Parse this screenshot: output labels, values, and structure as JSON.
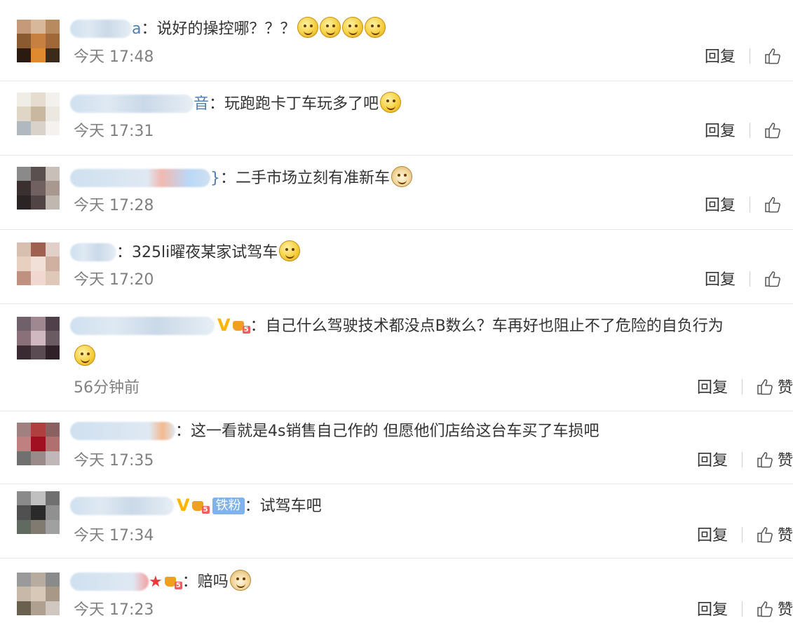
{
  "comments": [
    {
      "name_suffix": "a",
      "text": "说好的操控哪？？？",
      "time": "今天 17:48",
      "emojis": 4,
      "reply": "回复",
      "like": ""
    },
    {
      "name_suffix": "音",
      "text": "玩跑跑卡丁车玩多了吧",
      "time": "今天 17:31",
      "emojis": 1,
      "reply": "回复",
      "like": ""
    },
    {
      "name_suffix": "}",
      "text": "二手市场立刻有准新车",
      "time": "今天 17:28",
      "emojis": 1,
      "reply": "回复",
      "like": ""
    },
    {
      "name_suffix": "",
      "text": "325li曜夜某家试驾车",
      "time": "今天 17:20",
      "emojis": 1,
      "reply": "回复",
      "like": ""
    },
    {
      "name_suffix": "",
      "text": "自己什么驾驶技术都没点B数么？车再好也阻止不了危险的自负行为",
      "time": "56分钟前",
      "vip": "V",
      "reply": "回复",
      "like": "赞"
    },
    {
      "name_suffix": "",
      "text": "这一看就是4s销售自己作的 但愿他们店给这台车买了车损吧",
      "time": "今天 17:35",
      "reply": "回复",
      "like": "赞"
    },
    {
      "name_suffix": "",
      "text": "试驾车吧",
      "time": "今天 17:34",
      "vip": "V",
      "badge": "铁粉",
      "reply": "回复",
      "like": "赞"
    },
    {
      "name_suffix": "",
      "text": "赔吗",
      "time": "今天 17:23",
      "reply": "回复",
      "like": "赞"
    }
  ],
  "colors": {
    "time": "#808080",
    "vip": "#ffb400",
    "badge": "#7fb3ea",
    "separator": "#e6e6e6"
  }
}
